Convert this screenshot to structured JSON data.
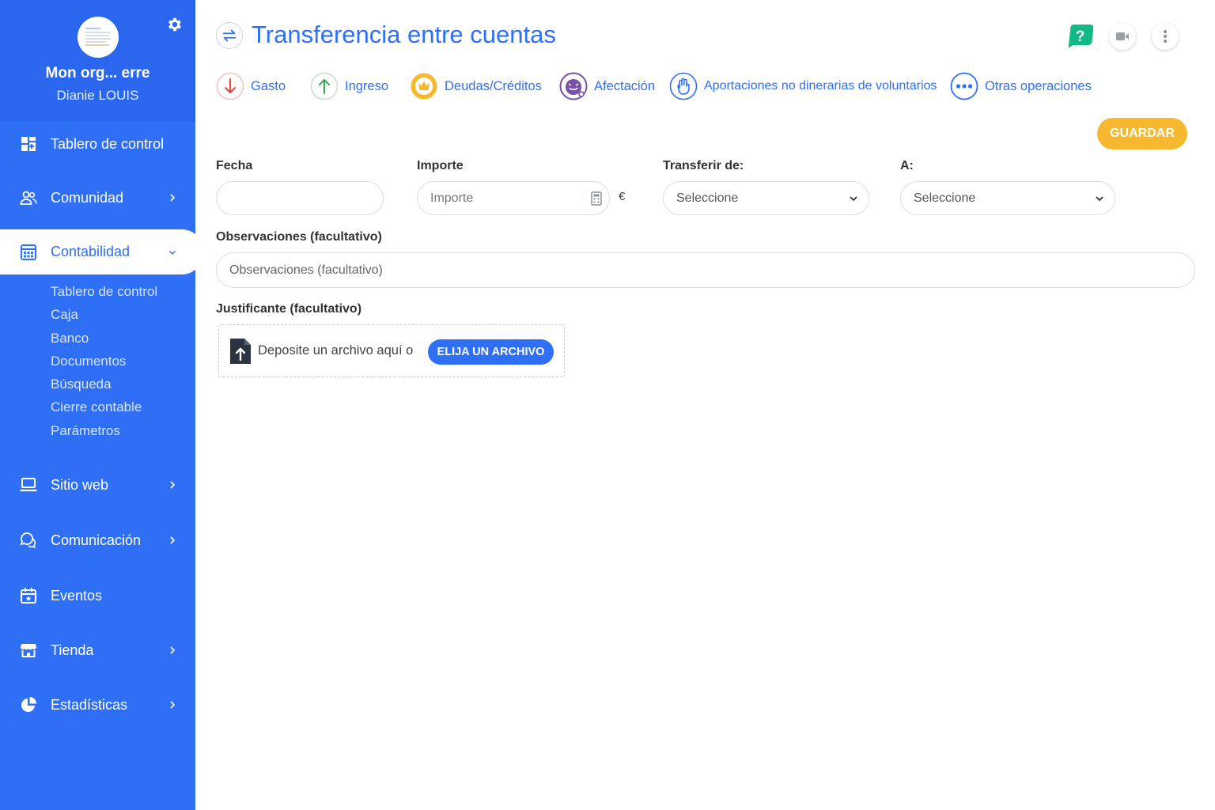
{
  "sidebar": {
    "org_name": "Mon org... erre",
    "user_name": "Dianie LOUIS",
    "items": [
      {
        "label": "Tablero de control",
        "icon": "dashboard-icon"
      },
      {
        "label": "Comunidad",
        "icon": "users-icon"
      },
      {
        "label": "Contabilidad",
        "icon": "calculator-icon"
      },
      {
        "label": "Sitio web",
        "icon": "laptop-icon"
      },
      {
        "label": "Comunicación",
        "icon": "chat-icon"
      },
      {
        "label": "Eventos",
        "icon": "calendar-icon"
      },
      {
        "label": "Tienda",
        "icon": "store-icon"
      },
      {
        "label": "Estadísticas",
        "icon": "pie-chart-icon"
      }
    ],
    "subitems": [
      "Tablero de control",
      "Caja",
      "Banco",
      "Documentos",
      "Búsqueda",
      "Cierre contable",
      "Parámetros"
    ]
  },
  "header": {
    "title": "Transferencia entre cuentas"
  },
  "operations": [
    {
      "label": "Gasto",
      "color": "#e8453c"
    },
    {
      "label": "Ingreso",
      "color": "#3aa35a"
    },
    {
      "label": "Deudas/Créditos",
      "color": "#f5b82e"
    },
    {
      "label": "Afectación",
      "color": "#7a4fa8"
    },
    {
      "label": "Aportaciones no dinerarias de voluntarios",
      "color": "#2f6ff5"
    },
    {
      "label": "Otras operaciones",
      "color": "#2f6ff5"
    }
  ],
  "actions": {
    "save_label": "GUARDAR"
  },
  "form": {
    "fecha_label": "Fecha",
    "importe_label": "Importe",
    "importe_placeholder": "Importe",
    "currency": "€",
    "from_label": "Transferir de:",
    "from_value": "Seleccione",
    "to_label": "A:",
    "to_value": "Seleccione",
    "obs_label": "Observaciones (facultativo)",
    "obs_placeholder": "Observaciones (facultativo)",
    "just_label": "Justificante (facultativo)",
    "drop_text": "Deposite un archivo aquí o",
    "choose_label": "ELIJA UN ARCHIVO"
  },
  "colors": {
    "primary": "#2f6ff5",
    "accent": "#f5b82e",
    "help": "#12b886"
  }
}
